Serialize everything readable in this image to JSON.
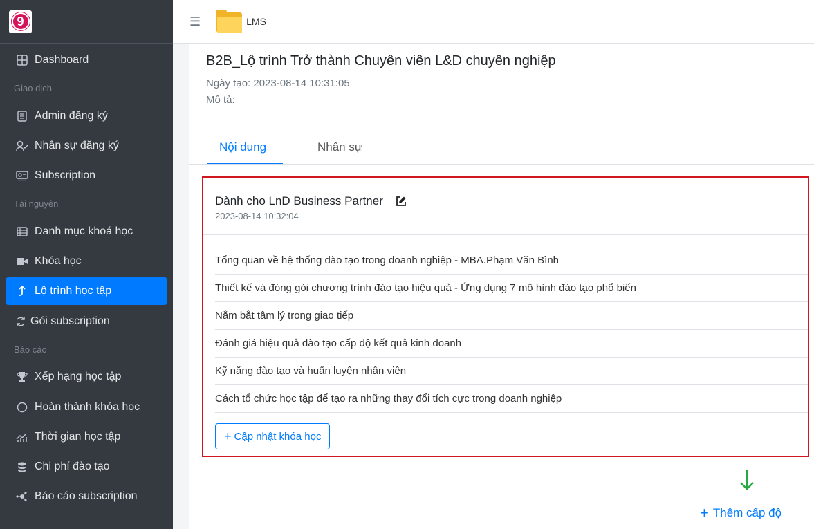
{
  "app": {
    "name": "LMS"
  },
  "sidebar": {
    "logo_letter": "9",
    "items": [
      {
        "label": "Dashboard",
        "icon": "dashboard-icon"
      },
      {
        "header": "Giao dịch"
      },
      {
        "label": "Admin đăng ký",
        "icon": "list-icon"
      },
      {
        "label": "Nhân sự đăng ký",
        "icon": "user-check-icon"
      },
      {
        "label": "Subscription",
        "icon": "subscription-icon"
      },
      {
        "header": "Tài nguyên"
      },
      {
        "label": "Danh mục khoá học",
        "icon": "table-icon"
      },
      {
        "label": "Khóa học",
        "icon": "video-icon"
      },
      {
        "label": "Lộ trình học tập",
        "icon": "arrow-up-icon",
        "active": true
      },
      {
        "label": "Gói subscription",
        "icon": "refresh-icon"
      },
      {
        "header": "Báo cáo"
      },
      {
        "label": "Xếp hạng học tập",
        "icon": "trophy-icon"
      },
      {
        "label": "Hoàn thành khóa học",
        "icon": "circle-icon"
      },
      {
        "label": "Thời gian học tập",
        "icon": "chart-icon"
      },
      {
        "label": "Chi phí đào tạo",
        "icon": "coins-icon"
      },
      {
        "label": "Báo cáo subscription",
        "icon": "network-icon"
      }
    ]
  },
  "page": {
    "title": "B2B_Lộ trình Trở thành Chuyên viên L&D chuyên nghiệp",
    "created": "Ngày tạo: 2023-08-14 10:31:05",
    "description": "Mô tả:"
  },
  "tabs": [
    {
      "label": "Nội dung",
      "active": true
    },
    {
      "label": "Nhân sự"
    }
  ],
  "level_card": {
    "title": "Dành cho LnD Business Partner",
    "date": "2023-08-14 10:32:04",
    "courses": [
      "Tổng quan về hệ thống đào tạo trong doanh nghiệp - MBA.Phạm Văn Bình",
      "Thiết kế và đóng gói chương trình đào tạo hiệu quả - Ứng dụng 7 mô hình đào tạo phổ biến",
      "Nắm bắt tâm lý trong giao tiếp",
      "Đánh giá hiệu quả đào tạo cấp độ kết quả kinh doanh",
      "Kỹ năng đào tạo và huấn luyện nhân viên",
      "Cách tổ chức học tập để tạo ra những thay đổi tích cực trong doanh nghiệp"
    ],
    "update_button": "Cập nhật khóa học"
  },
  "add_level": "Thêm cấp độ",
  "colors": {
    "primary": "#007bff",
    "sidebar": "#343a40",
    "highlight": "#d0161f",
    "arrow": "#28a745"
  }
}
